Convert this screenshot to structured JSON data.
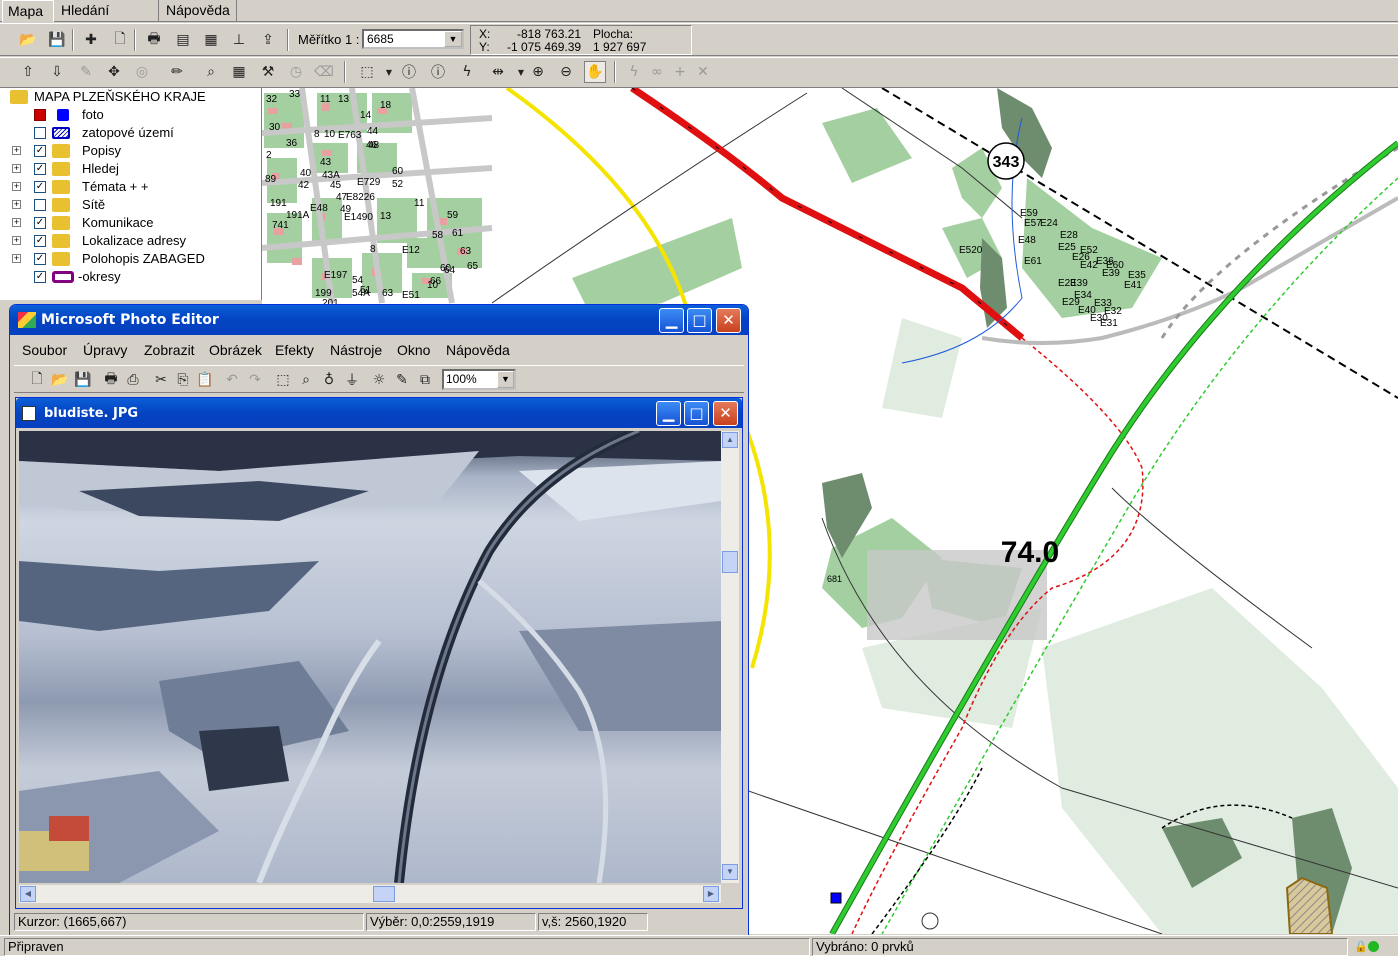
{
  "tabs": [
    "Mapa",
    "Hledání adresy",
    "Nápověda"
  ],
  "scale": {
    "label": "Měřítko 1 :",
    "value": "6685"
  },
  "coords": {
    "x_label": "X:",
    "x_value": "-818 763.21",
    "y_label": "Y:",
    "y_value": "-1 075 469.39",
    "area_label": "Plocha:",
    "area_value": "1 927 697"
  },
  "layers": [
    {
      "label": "MAPA PLZEŇSKÉHO KRAJE",
      "root": true
    },
    {
      "label": "foto",
      "checked": true
    },
    {
      "label": "zatopové území",
      "checked": false
    },
    {
      "label": "Popisy",
      "checked": true
    },
    {
      "label": "Hledej",
      "checked": true
    },
    {
      "label": "Témata + +",
      "checked": true
    },
    {
      "label": "Sítě",
      "checked": false
    },
    {
      "label": "Komunikace",
      "checked": true
    },
    {
      "label": "Lokalizace adresy",
      "checked": true
    },
    {
      "label": "Polohopis ZABAGED",
      "checked": true
    },
    {
      "label": "-okresy",
      "checked": true
    }
  ],
  "map": {
    "labels": {
      "road_343": "343",
      "km_74": "74.0",
      "e520": "E520",
      "n681": "681"
    },
    "house_numbers": [
      "33",
      "11",
      "13",
      "32",
      "14",
      "18",
      "30",
      "8",
      "10",
      "E763",
      "44",
      "36",
      "46",
      "2",
      "43",
      "48",
      "60",
      "89",
      "40",
      "43A",
      "E729",
      "52",
      "42",
      "45",
      "191",
      "E48",
      "47",
      "E8226",
      "191A",
      "E1490",
      "13",
      "59",
      "741",
      "49",
      "11",
      "61",
      "E12",
      "58",
      "63",
      "8",
      "60",
      "65",
      "E197",
      "64",
      "199",
      "54",
      "51",
      "66",
      "201",
      "54A",
      "63",
      "E51",
      "10"
    ],
    "east_labels": [
      "E59",
      "E57",
      "E24",
      "E48",
      "E28",
      "E25",
      "E52",
      "E61",
      "E26",
      "E36",
      "E42",
      "E60",
      "E39",
      "E35",
      "E23",
      "E41",
      "E39",
      "E34",
      "E29",
      "E33",
      "E40",
      "E32",
      "E30",
      "E31"
    ]
  },
  "photo_editor": {
    "title": "Microsoft Photo Editor",
    "menu": [
      "Soubor",
      "Úpravy",
      "Zobrazit",
      "Obrázek",
      "Efekty",
      "Nástroje",
      "Okno",
      "Nápověda"
    ],
    "zoom": "100%",
    "doc_title": "bludiste. JPG",
    "status": {
      "cursor": "Kurzor: (1665,667)",
      "selection": "Výběr: 0,0:2559,1919",
      "size": "v,š: 2560,1920"
    }
  },
  "statusbar": {
    "ready": "Připraven",
    "selected": "Vybráno: 0  prvků"
  },
  "colors": {
    "accent": "#0443c1",
    "green_road": "#2ecc2e",
    "red_road": "#e01010",
    "forest": "#9cc99c",
    "yellow_line": "#f5e400"
  }
}
